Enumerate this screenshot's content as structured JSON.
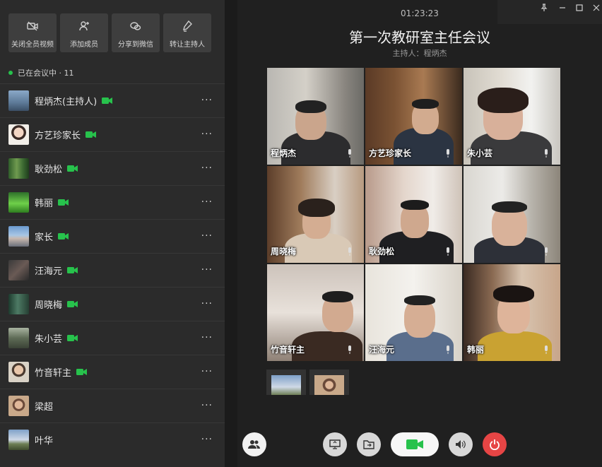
{
  "actions": [
    {
      "label": "关闭全员视频",
      "icon": "video-off-icon"
    },
    {
      "label": "添加成员",
      "icon": "add-person-icon"
    },
    {
      "label": "分享到微信",
      "icon": "wechat-icon"
    },
    {
      "label": "转让主持人",
      "icon": "transfer-host-icon"
    }
  ],
  "status": {
    "text": "已在会议中 · 11"
  },
  "members": [
    {
      "name": "程炳杰(主持人)",
      "camera": true,
      "more": "···"
    },
    {
      "name": "方艺珍家长",
      "camera": true,
      "more": "···"
    },
    {
      "name": "耿劲松",
      "camera": true,
      "more": "···"
    },
    {
      "name": "韩丽",
      "camera": true,
      "more": "···"
    },
    {
      "name": "家长",
      "camera": true,
      "more": "···"
    },
    {
      "name": "汪海元",
      "camera": true,
      "more": "···"
    },
    {
      "name": "周晓梅",
      "camera": true,
      "more": "···"
    },
    {
      "name": "朱小芸",
      "camera": true,
      "more": "···"
    },
    {
      "name": "竹音轩主",
      "camera": true,
      "more": "···"
    },
    {
      "name": "梁超",
      "camera": false,
      "more": "···"
    },
    {
      "name": "叶华",
      "camera": false,
      "more": "···"
    }
  ],
  "meeting": {
    "time": "01:23:23",
    "title": "第一次教研室主任会议",
    "host": "主持人：程炳杰"
  },
  "tiles": [
    {
      "name": "程炳杰"
    },
    {
      "name": "方艺珍家长"
    },
    {
      "name": "朱小芸"
    },
    {
      "name": "周晓梅"
    },
    {
      "name": "耿劲松"
    },
    {
      "name": ""
    },
    {
      "name": "竹音轩主"
    },
    {
      "name": "汪海元"
    },
    {
      "name": "韩丽"
    }
  ],
  "window_controls": [
    "pin-icon",
    "minimize-icon",
    "maximize-icon",
    "close-icon"
  ],
  "controls": [
    "members-icon",
    "screen-share-icon",
    "file-share-icon",
    "camera-icon",
    "speaker-icon",
    "power-icon"
  ],
  "colors": {
    "accent_green": "#27c24c",
    "hangup_red": "#e64545"
  }
}
